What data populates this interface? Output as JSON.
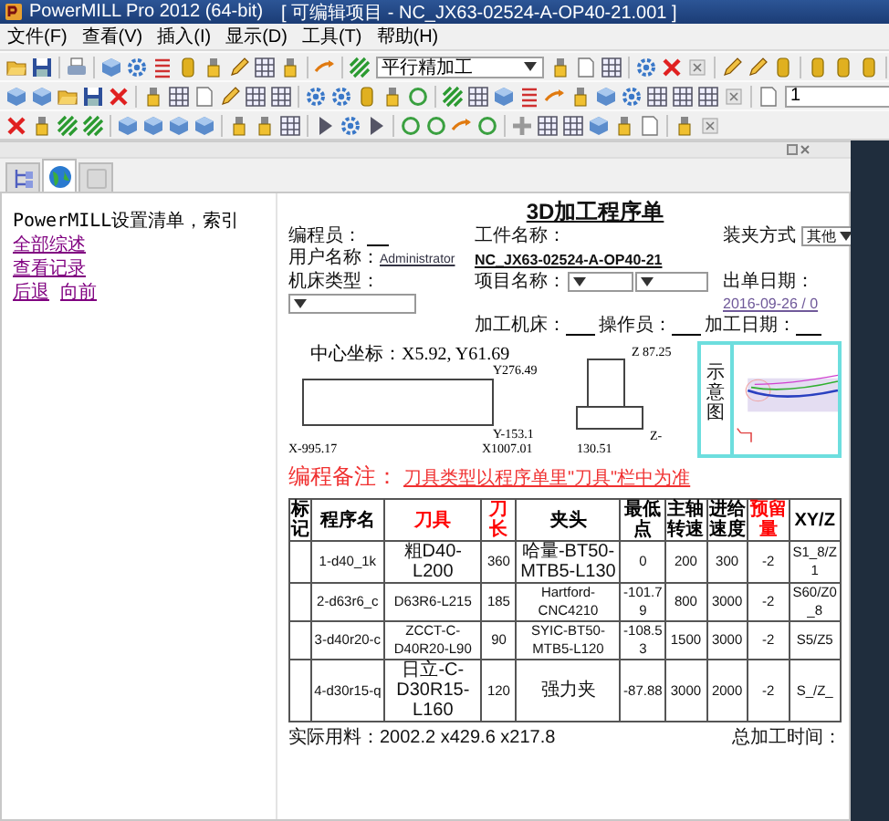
{
  "window": {
    "title": "PowerMILL Pro 2012 (64-bit)",
    "project": "[ 可编辑项目 - NC_JX63-02524-A-OP40-21.001 ]"
  },
  "menu": [
    "文件(F)",
    "查看(V)",
    "插入(I)",
    "显示(D)",
    "工具(T)",
    "帮助(H)"
  ],
  "toolbars": {
    "strategy": "平行精加工",
    "level": "1"
  },
  "panel_tabs": [
    {
      "kind": "tree",
      "selected": false
    },
    {
      "kind": "globe",
      "selected": true
    },
    {
      "kind": "blank",
      "selected": false
    }
  ],
  "nav": {
    "title": "PowerMILL设置清单，索引",
    "links": [
      "全部综述",
      "查看记录"
    ],
    "history": [
      "后退",
      "向前"
    ]
  },
  "sheet": {
    "title": "3D加工程序单",
    "programmer_label": "编程员：",
    "user_label": "用户名称：",
    "user": "Administrator",
    "machine_type_label": "机床类型：",
    "part_label": "工件名称：",
    "part": "NC_JX63-02524-A-OP40-21",
    "project_label": "项目名称：",
    "clamp_label": "装夹方式",
    "clamp": "其他",
    "date_label": "出单日期：",
    "date": "2016-09-26 / 0",
    "machine_label": "加工机床：",
    "operator_label": "操作员：",
    "work_date_label": "加工日期：",
    "center": "中心坐标：X5.92, Y61.69",
    "y_max": "Y276.49",
    "y_min": "Y-153.1",
    "x_min": "X-995.17",
    "x_max": "X1007.01",
    "z_max": "Z 87.25",
    "z_min": "Z-",
    "z_min_value": "130.51",
    "diagram_label": "示意图",
    "remark_label": "编程备注：",
    "remark": "刀具类型以程序单里\"刀具\"栏中为准",
    "table": {
      "columns": [
        {
          "label": "标记",
          "color": "#000000"
        },
        {
          "label": "程序名",
          "color": "#000000"
        },
        {
          "label": "刀具",
          "color": "#ff0000"
        },
        {
          "label": "刀长",
          "color": "#ff0000"
        },
        {
          "label": "夹头",
          "color": "#000000"
        },
        {
          "label": "最低点",
          "color": "#000000"
        },
        {
          "label": "主轴转速",
          "color": "#000000"
        },
        {
          "label": "进给速度",
          "color": "#000000"
        },
        {
          "label": "预留量",
          "color": "#ff0000"
        },
        {
          "label": "XY/Z",
          "color": "#000000"
        }
      ],
      "rows": [
        [
          "",
          "1-d40_1k",
          "粗D40-L200",
          "360",
          "哈量-BT50-MTB5-L130",
          "0",
          "200",
          "300",
          "-2",
          "S1_8/Z1"
        ],
        [
          "",
          "2-d63r6_c",
          "D63R6-L215",
          "185",
          "Hartford-CNC4210",
          "-101.79",
          "800",
          "3000",
          "-2",
          "S60/Z0_8"
        ],
        [
          "",
          "3-d40r20-c",
          "ZCCT-C-D40R20-L90",
          "90",
          "SYIC-BT50-MTB5-L120",
          "-108.53",
          "1500",
          "3000",
          "-2",
          "S5/Z5"
        ],
        [
          "",
          "4-d30r15-q",
          "日立-C-D30R15-L160",
          "120",
          "强力夹",
          "-87.88",
          "3000",
          "2000",
          "-2",
          "S_/Z_"
        ]
      ]
    },
    "stock": "实际用料：2002.2 x429.6 x217.8",
    "total_time_label": "总加工时间："
  }
}
